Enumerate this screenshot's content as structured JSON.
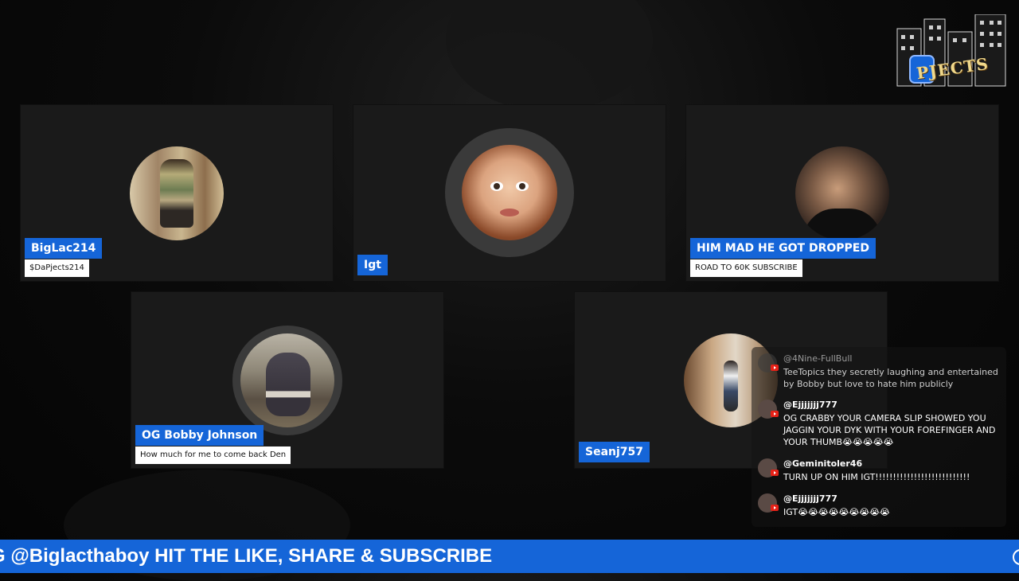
{
  "participants": [
    {
      "name": "BigLac214",
      "subtitle": "$DaPjects214"
    },
    {
      "name": "Igt",
      "subtitle": ""
    },
    {
      "name": "HIM MAD HE GOT DROPPED",
      "subtitle": "ROAD TO 60K SUBSCRIBE"
    },
    {
      "name": "OG Bobby Johnson",
      "subtitle": "How much for me to come back Den"
    },
    {
      "name": "Seanj757",
      "subtitle": ""
    }
  ],
  "logo": {
    "text": "PJECTS"
  },
  "chat": {
    "messages": [
      {
        "user": "@4Nine-FullBull",
        "text": "TeeTopics they secretly laughing and entertained by Bobby but love to hate him publicly"
      },
      {
        "user": "@Ejjjjjjj777",
        "text": "OG CRABBY YOUR CAMERA SLIP SHOWED YOU JAGGIN YOUR DYK WITH YOUR FOREFINGER AND YOUR THUMB😭😭😭😭😭"
      },
      {
        "user": "@Geminitoler46",
        "text": "TURN UP ON HIM IGT!!!!!!!!!!!!!!!!!!!!!!!!!!!"
      },
      {
        "user": "@Ejjjjjjj777",
        "text": "IGT😭😭😭😭😭😭😭😭😭"
      }
    ]
  },
  "ticker": {
    "text": "G @Biglacthaboy HIT THE LIKE, SHARE & SUBSCRIBE"
  },
  "colors": {
    "accent": "#1565d8",
    "tile": "#1a1a1a",
    "background": "#0b0b0b"
  }
}
